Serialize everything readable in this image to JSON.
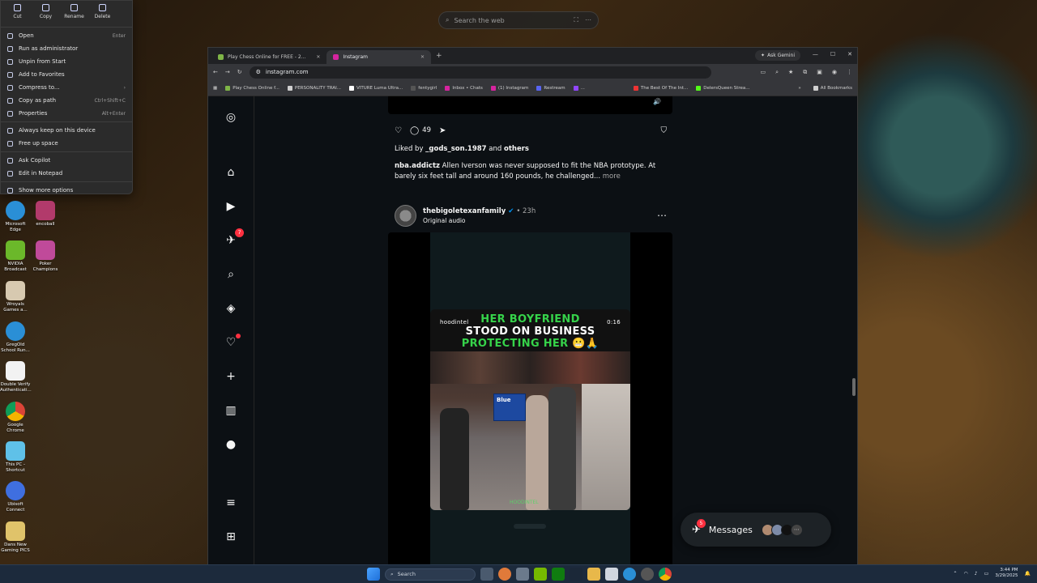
{
  "desktop_search": {
    "placeholder": "Search the web"
  },
  "context_menu": {
    "top_actions": [
      "Cut",
      "Copy",
      "Rename",
      "Delete"
    ],
    "items": [
      {
        "label": "Open",
        "shortcut": "Enter"
      },
      {
        "label": "Run as administrator",
        "shortcut": ""
      },
      {
        "label": "Unpin from Start",
        "shortcut": ""
      },
      {
        "label": "Add to Favorites",
        "shortcut": ""
      },
      {
        "label": "Compress to...",
        "shortcut": ""
      },
      {
        "label": "Copy as path",
        "shortcut": "Ctrl+Shift+C"
      },
      {
        "label": "Properties",
        "shortcut": "Alt+Enter"
      },
      {
        "label": "Always keep on this device",
        "shortcut": ""
      },
      {
        "label": "Free up space",
        "shortcut": ""
      },
      {
        "label": "Ask Copilot",
        "shortcut": ""
      },
      {
        "label": "Edit in Notepad",
        "shortcut": ""
      },
      {
        "label": "Show more options",
        "shortcut": ""
      }
    ]
  },
  "desktop_icons": [
    {
      "label": "Microsoft Edge",
      "color": "#2a8fd6"
    },
    {
      "label": "encoball",
      "color": "#b23a6b"
    },
    {
      "label": "NVIDIA Broadcast",
      "color": "#6bb82a"
    },
    {
      "label": "Poker Champions",
      "color": "#c04a9a"
    },
    {
      "label": "Wroyals Games a...",
      "color": "#d7c9b0"
    },
    {
      "label": "GregOld School Run...",
      "color": "#2a8fd6"
    },
    {
      "label": "Double Verify Authenticati...",
      "color": "#f2f2f2"
    },
    {
      "label": "Google Chrome",
      "color": "#e8b01a"
    },
    {
      "label": "This PC - Shortcut",
      "color": "#5fc1e8"
    },
    {
      "label": "Ubisoft Connect",
      "color": "#3f6fe0"
    },
    {
      "label": "Dans New Gaming PICS",
      "color": "#e0c36a"
    }
  ],
  "browser": {
    "tabs": [
      {
        "label": "Play Chess Online for FREE - 2...",
        "active": false,
        "favicon": "#7fb547"
      },
      {
        "label": "Instagram",
        "active": true,
        "favicon": "#d6249f"
      }
    ],
    "ask_gemini": "Ask Gemini",
    "url": "instagram.com",
    "bookmarks": [
      "Play Chess Online f...",
      "PERSONALITY TRAI...",
      "VITURE Luma Ultra...",
      "fentygirl",
      "Inbox • Chats",
      "(1) Instagram",
      "Restream",
      "...",
      "The Best Of The Int...",
      "DelersQueen Strea..."
    ],
    "all_bookmarks": "All Bookmarks"
  },
  "instagram": {
    "rail_badge": "7",
    "comments_count": "49",
    "liked_prefix": "Liked by ",
    "liked_user": "_gods_son.1987",
    "liked_mid": " and ",
    "liked_others": "others",
    "caption_user": "nba.addictz",
    "caption_text": " Allen Iverson was never supposed to fit the NBA prototype. At barely six feet tall and around 160 pounds, he challenged...",
    "caption_more": " more",
    "post_user": "thebigoletexanfamily",
    "post_time": "• 23h",
    "post_audio": "Original audio",
    "video": {
      "banner_line1": "HER BOYFRIEND",
      "banner_line2": "STOOD ON BUSINESS",
      "banner_line3": "PROTECTING HER 😬🙏",
      "handle": "hoodintel",
      "duration": "0:16",
      "sign_text": "Blue",
      "logo_text": "HOODINTEL"
    },
    "messages_label": "Messages",
    "messages_badge": "5"
  },
  "taskbar": {
    "search_placeholder": "Search",
    "time": "3:44 PM",
    "date": "3/29/2025"
  }
}
